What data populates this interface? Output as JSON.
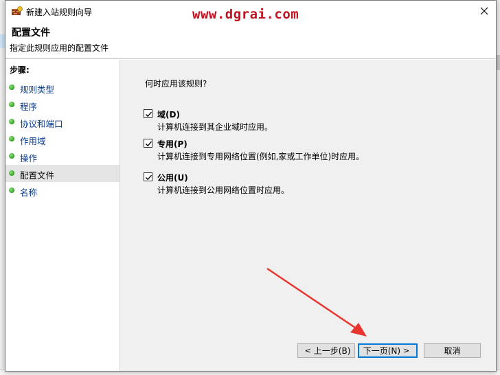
{
  "window": {
    "title": "新建入站规则向导",
    "watermark": "www.dgrai.com"
  },
  "header": {
    "title": "配置文件",
    "subtitle": "指定此规则应用的配置文件"
  },
  "sidebar": {
    "steps_label": "步骤:",
    "items": [
      {
        "label": "规则类型"
      },
      {
        "label": "程序"
      },
      {
        "label": "协议和端口"
      },
      {
        "label": "作用域"
      },
      {
        "label": "操作"
      },
      {
        "label": "配置文件"
      },
      {
        "label": "名称"
      }
    ]
  },
  "content": {
    "question": "何时应用该规则?",
    "options": [
      {
        "title": "域(D)",
        "desc": "计算机连接到其企业域时应用。",
        "checked": true
      },
      {
        "title": "专用(P)",
        "desc": "计算机连接到专用网络位置(例如,家或工作单位)时应用。",
        "checked": true
      },
      {
        "title": "公用(U)",
        "desc": "计算机连接到公用网络位置时应用。",
        "checked": true
      }
    ]
  },
  "buttons": {
    "back_label": "上一步(B)",
    "next_label": "下一页(N)",
    "cancel_label": "取消"
  },
  "icons": {
    "app": "firewall-wizard-icon",
    "close": "close-icon",
    "step_dot": "green-dot-icon",
    "check": "checkmark-icon"
  },
  "colors": {
    "watermark": "#c1121f",
    "link": "#0a3c8c",
    "accent": "#0078d7",
    "arrow": "#e8362f",
    "step_dot": "#2ea01e"
  }
}
